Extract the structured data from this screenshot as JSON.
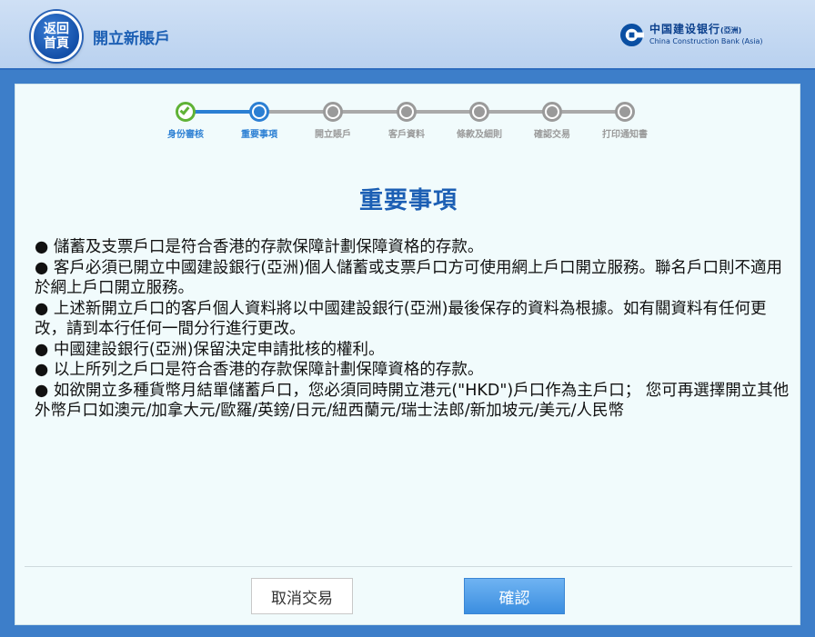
{
  "header": {
    "home_line1": "返回",
    "home_line2": "首頁",
    "title": "開立新賬戶",
    "logo_cn": "中国建设银行",
    "logo_cn_suffix": "(亞洲)",
    "logo_en": "China Construction Bank (Asia)"
  },
  "stepper": {
    "steps": [
      {
        "label": "身份審核",
        "state": "complete"
      },
      {
        "label": "重要事項",
        "state": "current"
      },
      {
        "label": "開立賬戶",
        "state": "pending"
      },
      {
        "label": "客戶資料",
        "state": "pending"
      },
      {
        "label": "條款及細則",
        "state": "pending"
      },
      {
        "label": "確認交易",
        "state": "pending"
      },
      {
        "label": "打印通知書",
        "state": "pending"
      }
    ]
  },
  "main": {
    "heading": "重要事項",
    "notes": [
      "● 儲蓄及支票戶口是符合香港的存款保障計劃保障資格的存款。",
      "● 客戶必須已開立中國建設銀行(亞洲)個人儲蓄或支票戶口方可使用網上戶口開立服務。聯名戶口則不適用於網上戶口開立服務。",
      "● 上述新開立戶口的客戶個人資料將以中國建設銀行(亞洲)最後保存的資料為根據。如有關資料有任何更改，請到本行任何一間分行進行更改。",
      "● 中國建設銀行(亞洲)保留決定申請批核的權利。",
      "● 以上所列之戶口是符合香港的存款保障計劃保障資格的存款。",
      "● 如欲開立多種貨幣月結單儲蓄戶口，您必須同時開立港元(\"HKD\")戶口作為主戶口； 您可再選擇開立其他外幣戶口如澳元/加拿大元/歐羅/英鎊/日元/紐西蘭元/瑞士法郎/新加坡元/美元/人民幣"
    ]
  },
  "footer": {
    "cancel_label": "取消交易",
    "confirm_label": "確認"
  }
}
